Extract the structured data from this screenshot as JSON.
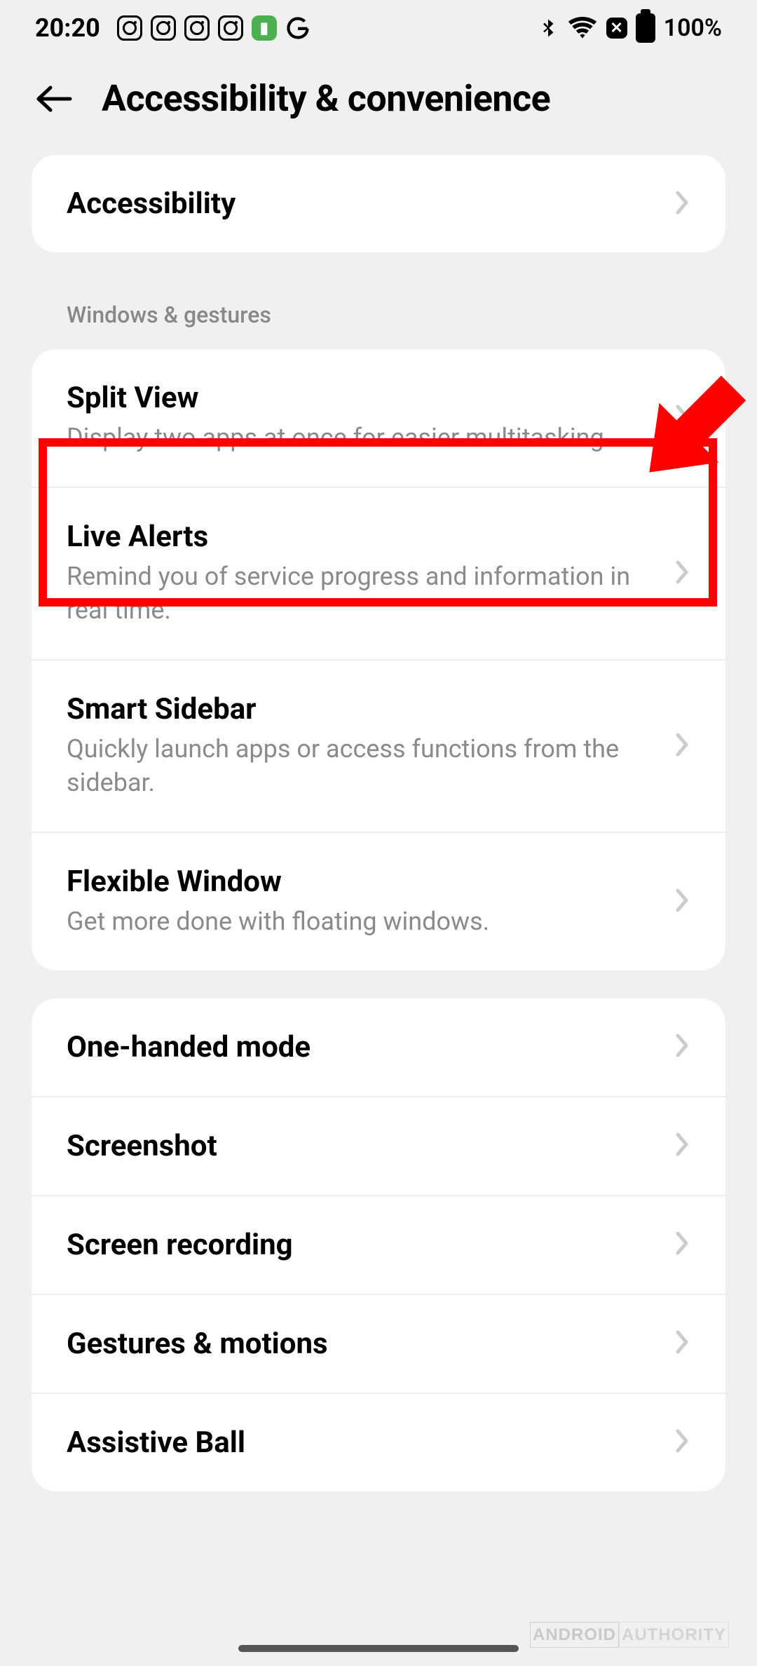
{
  "status": {
    "time": "20:20",
    "battery": "100%"
  },
  "header": {
    "title": "Accessibility & convenience"
  },
  "groups": [
    {
      "label": null,
      "items": [
        {
          "title": "Accessibility",
          "desc": null
        }
      ]
    },
    {
      "label": "Windows & gestures",
      "items": [
        {
          "title": "Split View",
          "desc": "Display two apps at once for easier multitasking."
        },
        {
          "title": "Live Alerts",
          "desc": "Remind you of service progress and information in real time."
        },
        {
          "title": "Smart Sidebar",
          "desc": "Quickly launch apps or access functions from the sidebar."
        },
        {
          "title": "Flexible Window",
          "desc": "Get more done with floating windows."
        }
      ]
    },
    {
      "label": null,
      "items": [
        {
          "title": "One-handed mode",
          "desc": null
        },
        {
          "title": "Screenshot",
          "desc": null
        },
        {
          "title": "Screen recording",
          "desc": null
        },
        {
          "title": "Gestures & motions",
          "desc": null
        },
        {
          "title": "Assistive Ball",
          "desc": null
        }
      ]
    }
  ],
  "watermark": {
    "a": "ANDROID",
    "b": "AUTHORITY"
  }
}
